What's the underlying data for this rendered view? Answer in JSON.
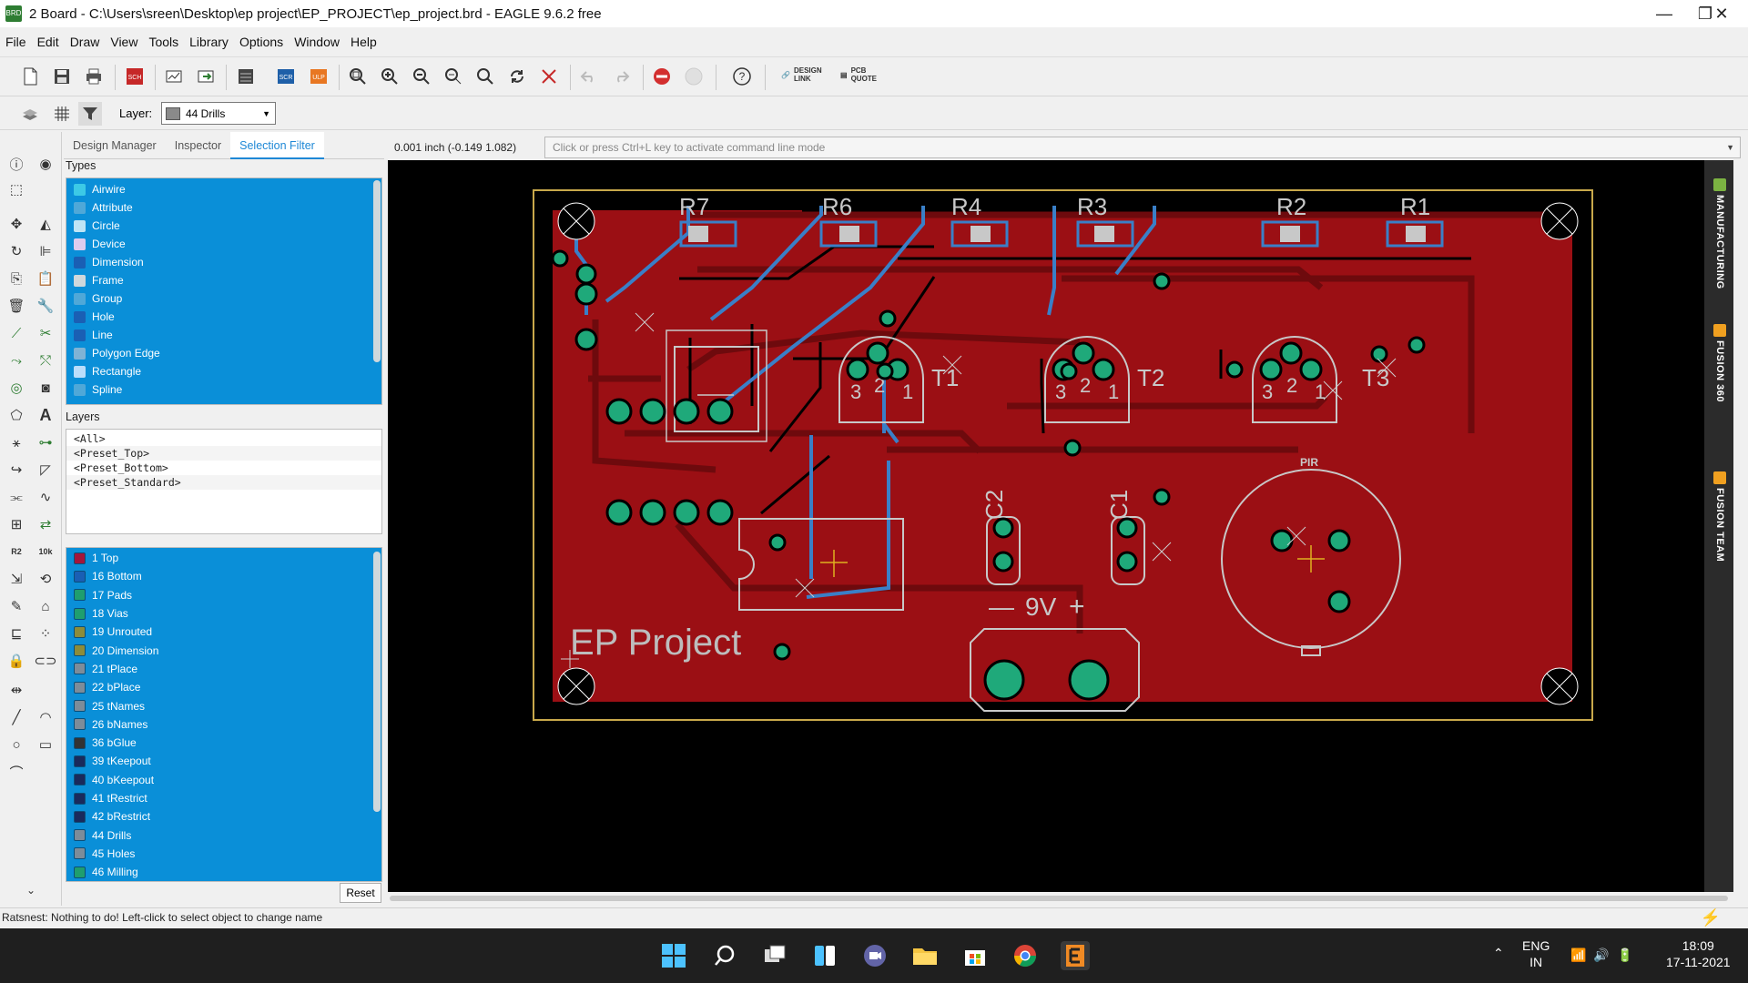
{
  "window": {
    "title": "2 Board - C:\\Users\\sreen\\Desktop\\ep project\\EP_PROJECT\\ep_project.brd - EAGLE 9.6.2 free",
    "app_icon_text": "BRD",
    "minimize": "—",
    "restore": "❐",
    "close": "✕"
  },
  "menu": [
    "File",
    "Edit",
    "Draw",
    "View",
    "Tools",
    "Library",
    "Options",
    "Window",
    "Help"
  ],
  "toolbar": {
    "scr_label": "SCR",
    "ulp_label": "ULP",
    "sch_label": "SCH",
    "help_label": "?",
    "design_link": "DESIGN\nLINK",
    "pcb_quote": "PCB\nQUOTE"
  },
  "layer_bar": {
    "label": "Layer:",
    "selected_layer": "44 Drills"
  },
  "panel": {
    "tabs": [
      "Design Manager",
      "Inspector",
      "Selection Filter"
    ],
    "active_tab": "Selection Filter",
    "types_label": "Types",
    "types": [
      "Airwire",
      "Attribute",
      "Circle",
      "Device",
      "Dimension",
      "Frame",
      "Group",
      "Hole",
      "Line",
      "Polygon Edge",
      "Rectangle",
      "Spline"
    ],
    "layers_label": "Layers",
    "presets": [
      "<All>",
      "<Preset_Top>",
      "<Preset_Bottom>",
      "<Preset_Standard>"
    ],
    "layer_list": [
      {
        "name": "1 Top",
        "color": "#a3163b"
      },
      {
        "name": "16 Bottom",
        "color": "#1a5fb4"
      },
      {
        "name": "17 Pads",
        "color": "#1f9e6e"
      },
      {
        "name": "18 Vias",
        "color": "#1f9e6e"
      },
      {
        "name": "19 Unrouted",
        "color": "#8c8c3a"
      },
      {
        "name": "20 Dimension",
        "color": "#8c8c3a"
      },
      {
        "name": "21 tPlace",
        "color": "#7d8c99"
      },
      {
        "name": "22 bPlace",
        "color": "#7d8c99"
      },
      {
        "name": "25 tNames",
        "color": "#7d8c99"
      },
      {
        "name": "26 bNames",
        "color": "#7d8c99"
      },
      {
        "name": "36 bGlue",
        "color": "#333333"
      },
      {
        "name": "39 tKeepout",
        "color": "#1a2a5c"
      },
      {
        "name": "40 bKeepout",
        "color": "#1a2a5c"
      },
      {
        "name": "41 tRestrict",
        "color": "#1a2a5c"
      },
      {
        "name": "42 bRestrict",
        "color": "#1a2a5c"
      },
      {
        "name": "44 Drills",
        "color": "#7d8c99"
      },
      {
        "name": "45 Holes",
        "color": "#7d8c99"
      },
      {
        "name": "46 Milling",
        "color": "#1f9e6e"
      }
    ],
    "reset": "Reset"
  },
  "coords": "0.001 inch (-0.149 1.082)",
  "command_placeholder": "Click or press Ctrl+L key to activate command line mode",
  "board": {
    "resistors": [
      "R7",
      "R6",
      "R4",
      "R3",
      "R2",
      "R1"
    ],
    "transistors": [
      "T1",
      "T2",
      "T3"
    ],
    "caps": [
      "C2",
      "C1"
    ],
    "pir": "PIR",
    "battery_label": "9V",
    "minus": "—",
    "plus": "+",
    "pin_labels": [
      "3",
      "2",
      "1"
    ],
    "project_text": "EP Project"
  },
  "side_tabs": [
    "MANUFACTURING",
    "FUSION 360",
    "FUSION TEAM"
  ],
  "status": "Ratsnest: Nothing to do! Left-click to select object to change name",
  "tray": {
    "lang1": "ENG",
    "lang2": "IN",
    "time": "18:09",
    "date": "17-11-2021"
  },
  "colors": {
    "board_fill": "#9b0f14",
    "board_edge": "#c8a84b",
    "top_trace": "#7d0d10",
    "bottom_trace": "#3a7fc7",
    "pad": "#1fa97a",
    "selection_blue": "#0a8fd8"
  }
}
